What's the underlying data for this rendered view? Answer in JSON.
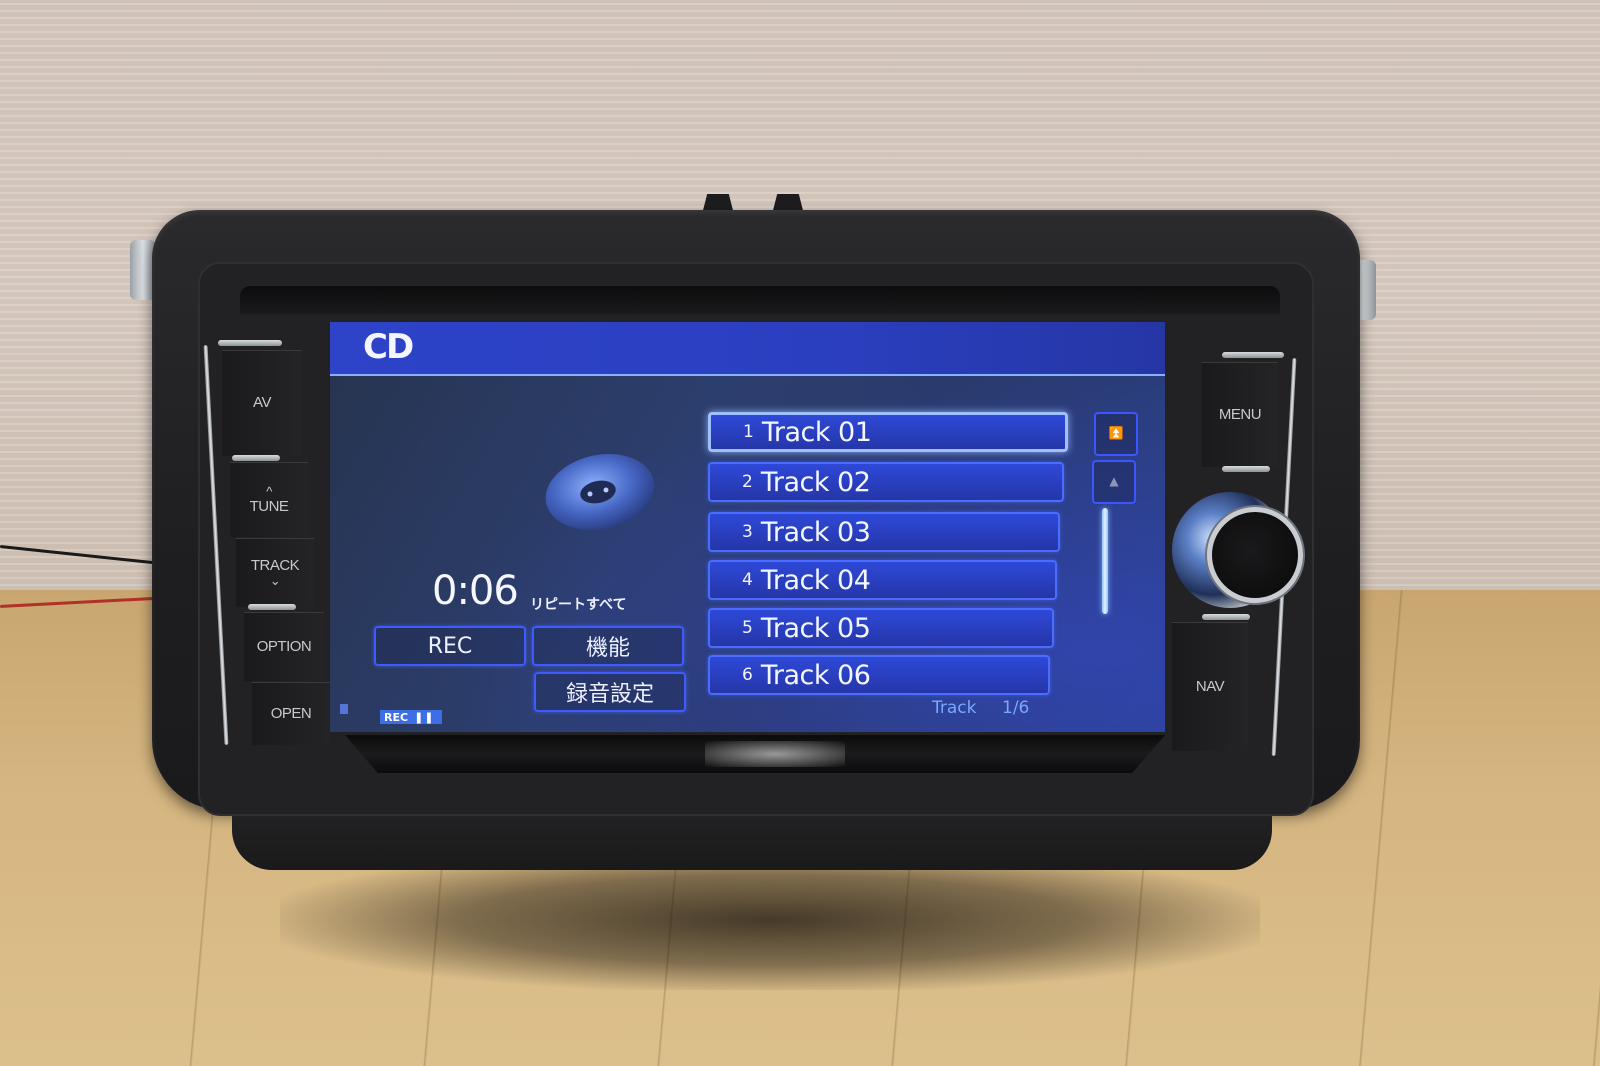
{
  "screen": {
    "title": "CD",
    "playback": {
      "elapsed": "0:06",
      "repeat_mode": "リピートすべて"
    },
    "buttons": {
      "rec": "REC",
      "function": "機能",
      "rec_settings": "録音設定"
    },
    "rec_status": {
      "label": "REC",
      "state_icon": "pause-icon",
      "state_glyph": "❚❚"
    },
    "track_list": {
      "selected_index": 0,
      "items": [
        {
          "num": "1",
          "title": "Track 01"
        },
        {
          "num": "2",
          "title": "Track 02"
        },
        {
          "num": "3",
          "title": "Track 03"
        },
        {
          "num": "4",
          "title": "Track 04"
        },
        {
          "num": "5",
          "title": "Track 05"
        },
        {
          "num": "6",
          "title": "Track 06"
        }
      ],
      "page_label": "Track",
      "page_count": "1/6",
      "scroll_top_glyph": "⏫",
      "scroll_up_glyph": "▲"
    }
  },
  "hardware": {
    "left_buttons": [
      {
        "label": "AV"
      },
      {
        "label": "TUNE",
        "glyph": "^"
      },
      {
        "label": "TRACK",
        "glyph": "⌄"
      },
      {
        "label": "OPTION"
      },
      {
        "label": "OPEN"
      }
    ],
    "right_buttons": [
      {
        "label": "MENU"
      },
      {
        "label": "NAV"
      }
    ]
  },
  "colors": {
    "accent_blue": "#2d43c8",
    "highlight": "#9ec0ff",
    "status_text": "#7aa7ff"
  }
}
